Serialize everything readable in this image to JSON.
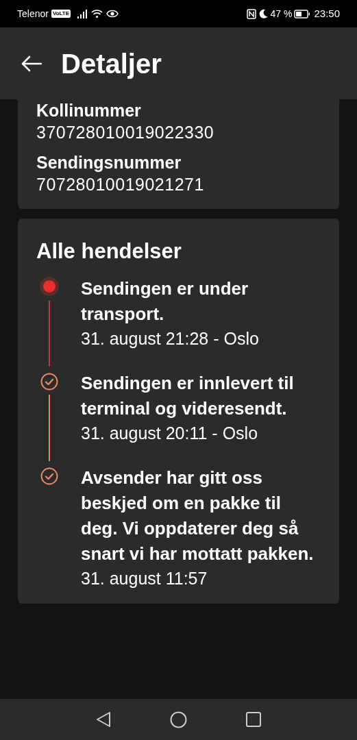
{
  "status_bar": {
    "carrier": "Telenor",
    "volte": "VoLTE",
    "battery": "47 %",
    "time": "23:50"
  },
  "header": {
    "title": "Detaljer"
  },
  "details": [
    {
      "label": "Kollinummer",
      "value": "370728010019022330"
    },
    {
      "label": "Sendingsnummer",
      "value": "70728010019021271"
    }
  ],
  "events_card": {
    "title": "Alle hendelser",
    "events": [
      {
        "kind": "current",
        "title": "Sendingen er under transport.",
        "meta": "31. august 21:28 - Oslo"
      },
      {
        "kind": "done",
        "title": "Sendingen er innlevert til terminal og videresendt.",
        "meta": "31. august 20:11 - Oslo"
      },
      {
        "kind": "done",
        "title": "Avsender har gitt oss beskjed om en pakke til deg. Vi oppdaterer deg så snart vi har mottatt pakken.",
        "meta": "31. august 11:57"
      }
    ]
  }
}
